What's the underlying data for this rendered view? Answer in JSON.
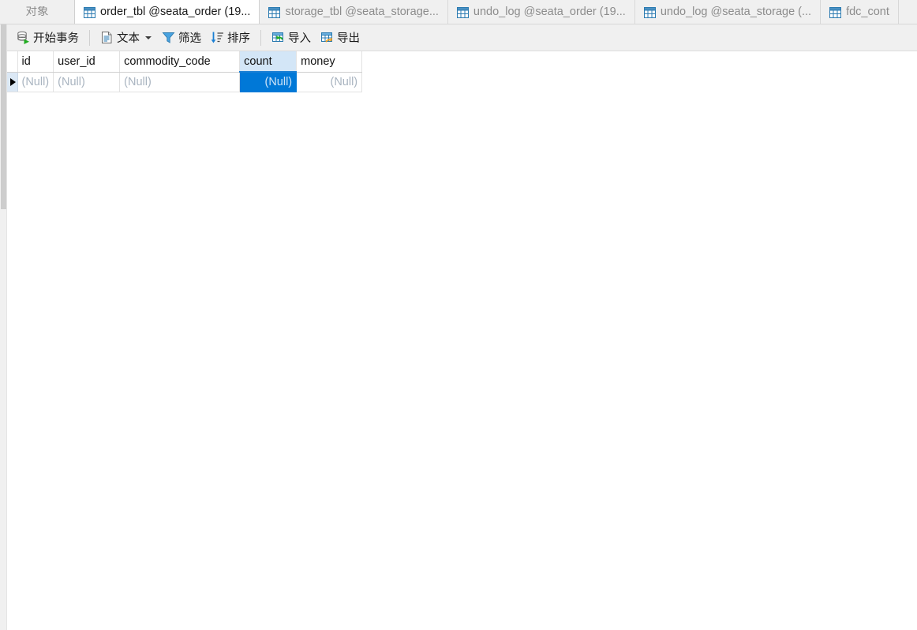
{
  "window": {
    "app": "Navicat",
    "background": "#ffffff",
    "accent": "#0078d7",
    "header_highlight": "#d3e6f7",
    "toolbar_bg": "#f0f0f0"
  },
  "tabs": [
    {
      "label": "对象",
      "icon": "",
      "active": false,
      "kind": "objects"
    },
    {
      "label": "order_tbl @seata_order (19...",
      "icon": "table-icon",
      "active": true,
      "kind": "table"
    },
    {
      "label": "storage_tbl @seata_storage...",
      "icon": "table-icon",
      "active": false,
      "kind": "table"
    },
    {
      "label": "undo_log @seata_order (19...",
      "icon": "table-icon",
      "active": false,
      "kind": "table"
    },
    {
      "label": "undo_log @seata_storage (...",
      "icon": "table-icon",
      "active": false,
      "kind": "table"
    },
    {
      "label": "fdc_cont",
      "icon": "table-icon",
      "active": false,
      "kind": "table"
    }
  ],
  "toolbar": {
    "items": [
      {
        "label": "开始事务",
        "icon": "begin-transaction-icon",
        "caret": false
      },
      {
        "sep": true
      },
      {
        "label": "文本",
        "icon": "text-icon",
        "caret": true
      },
      {
        "label": "筛选",
        "icon": "filter-icon",
        "caret": false
      },
      {
        "label": "排序",
        "icon": "sort-icon",
        "caret": false
      },
      {
        "sep": true
      },
      {
        "label": "导入",
        "icon": "import-icon",
        "caret": false
      },
      {
        "label": "导出",
        "icon": "export-icon",
        "caret": false
      }
    ]
  },
  "grid": {
    "columns": [
      {
        "name": "id",
        "key": "id",
        "align": "left",
        "highlighted": false
      },
      {
        "name": "user_id",
        "key": "user_id",
        "align": "left",
        "highlighted": false
      },
      {
        "name": "commodity_code",
        "key": "commodity_code",
        "align": "left",
        "highlighted": false
      },
      {
        "name": "count",
        "key": "count",
        "align": "right",
        "highlighted": true
      },
      {
        "name": "money",
        "key": "money",
        "align": "right",
        "highlighted": false
      }
    ],
    "rows": [
      {
        "current": true,
        "cells": {
          "id": "(Null)",
          "user_id": "(Null)",
          "commodity_code": "(Null)",
          "count": "(Null)",
          "money": "(Null)"
        },
        "selected_cell": "count"
      }
    ]
  }
}
